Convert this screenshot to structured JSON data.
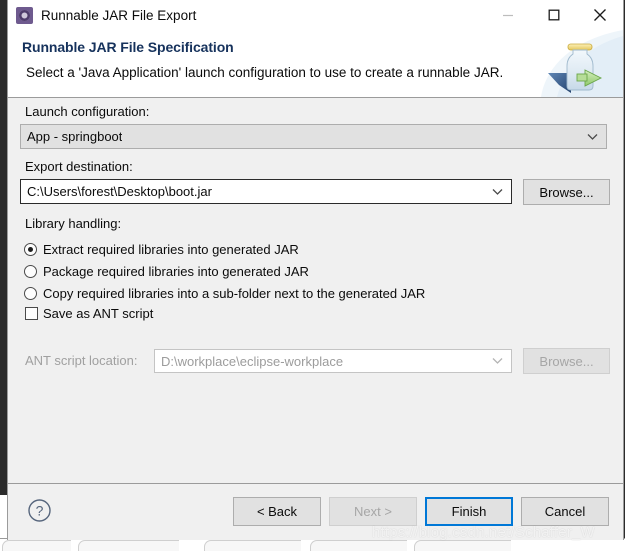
{
  "window": {
    "title": "Runnable JAR File Export",
    "icon": "eclipse-jar-export-icon",
    "controls": {
      "minimize": "minimize-icon",
      "maximize": "maximize-icon",
      "close": "close-icon"
    }
  },
  "header": {
    "title": "Runnable JAR File Specification",
    "description": "Select a 'Java Application' launch configuration to use to create a runnable JAR.",
    "graphic": "jar-export-banner-icon"
  },
  "form": {
    "launch_configuration": {
      "label": "Launch configuration:",
      "value": "App - springboot",
      "arrow": "chevron-down-icon"
    },
    "export_destination": {
      "label": "Export destination:",
      "value": "C:\\Users\\forest\\Desktop\\boot.jar",
      "arrow": "chevron-down-icon",
      "browse_label": "Browse..."
    },
    "library_handling": {
      "label": "Library handling:",
      "options": [
        {
          "label": "Extract required libraries into generated JAR",
          "selected": true
        },
        {
          "label": "Package required libraries into generated JAR",
          "selected": false
        },
        {
          "label": "Copy required libraries into a sub-folder next to the generated JAR",
          "selected": false
        }
      ]
    },
    "save_as_ant": {
      "label": "Save as ANT script",
      "checked": false
    },
    "ant_script_location": {
      "label": "ANT script location:",
      "value": "D:\\workplace\\eclipse-workplace",
      "arrow": "chevron-down-icon",
      "browse_label": "Browse...",
      "enabled": false
    }
  },
  "footer": {
    "help": "help-icon",
    "buttons": [
      {
        "label": "< Back",
        "state": "enabled"
      },
      {
        "label": "Next >",
        "state": "disabled"
      },
      {
        "label": "Finish",
        "state": "default"
      },
      {
        "label": "Cancel",
        "state": "enabled"
      }
    ]
  },
  "watermark": {
    "text": "https://blog.csdn.net/Schaffer_W"
  },
  "colors": {
    "accent": "#0078d7",
    "header_title": "#16325c",
    "dialog_bg": "#f0f0f0",
    "backdrop": "#2b2b2b"
  }
}
